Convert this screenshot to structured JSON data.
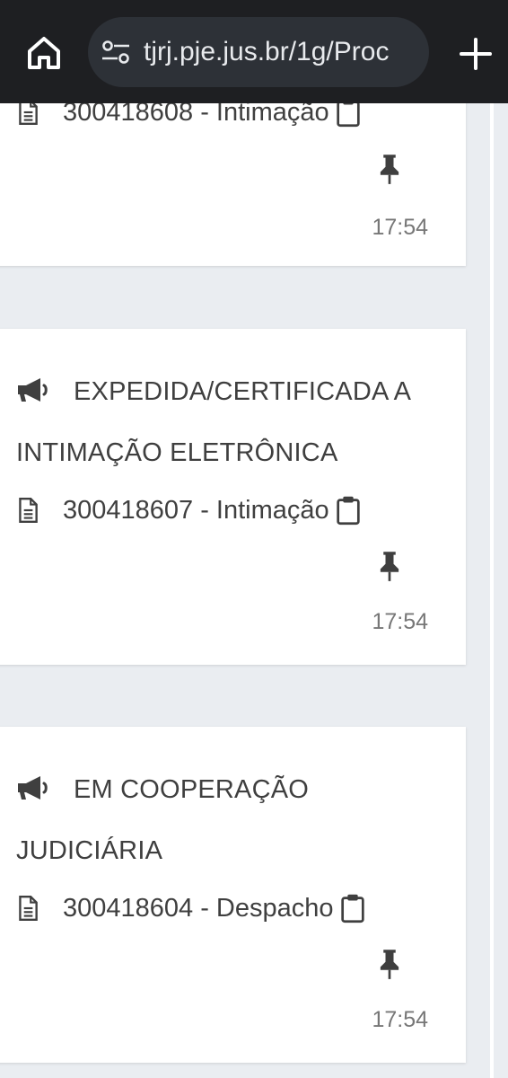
{
  "browser": {
    "url": "tjrj.pje.jus.br/1g/Proc",
    "home_icon": "home-icon",
    "site_settings_icon": "tune-icon",
    "new_tab_icon": "plus-icon"
  },
  "colors": {
    "toolbar_bg": "#1e1f22",
    "url_pill_bg": "#2d3137",
    "page_bg": "#eaedf1",
    "card_bg": "#ffffff",
    "text": "#3f3f3f",
    "time_text": "#777777"
  },
  "events": [
    {
      "title": "",
      "document": "300418608 - Intimação",
      "time": "17:54"
    },
    {
      "title": "EXPEDIDA/CERTIFICADA A INTIMAÇÃO ELETRÔNICA",
      "document": "300418607 - Intimação",
      "time": "17:54"
    },
    {
      "title": "EM COOPERAÇÃO JUDICIÁRIA",
      "document": "300418604 - Despacho",
      "time": "17:54"
    }
  ]
}
